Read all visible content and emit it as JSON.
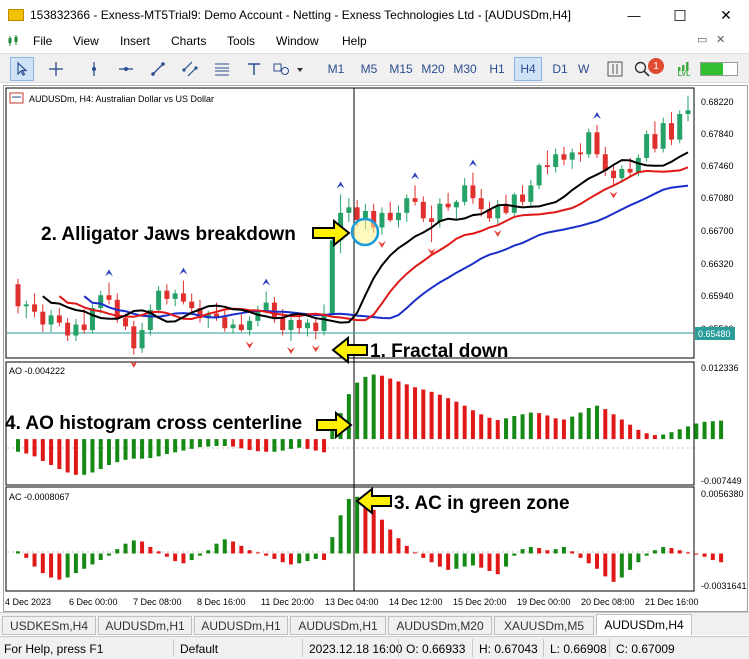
{
  "window": {
    "title": "153832366 - Exness-MT5Trial9: Demo Account - Netting - Exness Technologies Ltd - [AUDUSDm,H4]",
    "minimize_glyph": "—",
    "maximize_glyph": "☐",
    "close_glyph": "✕",
    "restore_glyph": "▭",
    "inner_close_glyph": "✕"
  },
  "menu": {
    "items": [
      "File",
      "View",
      "Insert",
      "Charts",
      "Tools",
      "Window",
      "Help"
    ]
  },
  "toolbar": {
    "timeframes": [
      "M1",
      "M5",
      "M15",
      "M20",
      "M30",
      "H1",
      "H4",
      "D1",
      "W"
    ],
    "active_timeframe": "H4",
    "notification_count": "1",
    "lvl_label": "LVL",
    "icons": [
      "cursor-icon",
      "crosshair-icon",
      "vertical-line-icon",
      "horizontal-line-icon",
      "trendline-icon",
      "channel-icon",
      "fibonacci-icon",
      "text-icon",
      "shapes-icon",
      "chart-type-icon",
      "search-icon",
      "notification-icon",
      "signal-icon"
    ]
  },
  "chart": {
    "symbol_label": "AUDUSDm, H4:  Australian Dollar vs US Dollar",
    "price_labels": [
      "0.68220",
      "0.67840",
      "0.67460",
      "0.67080",
      "0.66700",
      "0.66320",
      "0.65940",
      "0.65560"
    ],
    "current_price": "0.65480",
    "ao_label": "AO -0.004222",
    "ao_max": "0.012336",
    "ao_min": "-0.007449",
    "ac_label": "AC -0.0008067",
    "ac_max": "0.0056380",
    "ac_min": "-0.0031641",
    "date_labels": [
      "4 Dec 2023",
      "6 Dec 00:00",
      "7 Dec 08:00",
      "8 Dec 16:00",
      "11 Dec 20:00",
      "13 Dec 04:00",
      "14 Dec 12:00",
      "15 Dec 20:00",
      "19 Dec 00:00",
      "20 Dec 08:00",
      "21 Dec 16:00"
    ],
    "annotations": {
      "jaws": "2. Alligator Jaws breakdown",
      "fractal": "1. Fractal down",
      "ao": "4. AO histogram cross centerline",
      "ac": "3. AC in green zone"
    },
    "colors": {
      "bull": "#26a269",
      "bear": "#e0302e",
      "jaws": "#1a2ecc",
      "teeth": "#e01818",
      "lips": "#000000",
      "fractal_up": "#2b3fbf",
      "fractal_down": "#e33d2e",
      "arrow_fill": "#ffef00",
      "ao_green": "#148a14",
      "ao_red": "#e01818"
    }
  },
  "chart_data": {
    "type": "candlestick",
    "symbol": "AUDUSDm",
    "timeframe": "H4",
    "ylim": [
      0.6548,
      0.6832
    ],
    "price_series": [
      [
        0.6622,
        0.6628,
        0.659,
        0.6598
      ],
      [
        0.6598,
        0.6604,
        0.6585,
        0.66
      ],
      [
        0.66,
        0.6612,
        0.6586,
        0.6592
      ],
      [
        0.6592,
        0.66,
        0.657,
        0.6578
      ],
      [
        0.6578,
        0.6594,
        0.657,
        0.6588
      ],
      [
        0.6588,
        0.6596,
        0.6576,
        0.658
      ],
      [
        0.658,
        0.6585,
        0.656,
        0.6566
      ],
      [
        0.6566,
        0.6584,
        0.656,
        0.6578
      ],
      [
        0.6578,
        0.6595,
        0.6568,
        0.6572
      ],
      [
        0.6572,
        0.66,
        0.6568,
        0.6596
      ],
      [
        0.6596,
        0.6615,
        0.659,
        0.661
      ],
      [
        0.661,
        0.6624,
        0.66,
        0.6605
      ],
      [
        0.6605,
        0.6612,
        0.658,
        0.6585
      ],
      [
        0.6585,
        0.659,
        0.6572,
        0.6576
      ],
      [
        0.6576,
        0.6582,
        0.6545,
        0.6552
      ],
      [
        0.6552,
        0.658,
        0.6547,
        0.6572
      ],
      [
        0.6572,
        0.66,
        0.6566,
        0.6594
      ],
      [
        0.6594,
        0.662,
        0.659,
        0.6615
      ],
      [
        0.6615,
        0.6622,
        0.66,
        0.6606
      ],
      [
        0.6606,
        0.6616,
        0.6598,
        0.6612
      ],
      [
        0.6612,
        0.6626,
        0.66,
        0.6603
      ],
      [
        0.6603,
        0.6612,
        0.659,
        0.6596
      ],
      [
        0.6596,
        0.6605,
        0.658,
        0.6585
      ],
      [
        0.6585,
        0.6593,
        0.6574,
        0.659
      ],
      [
        0.659,
        0.6602,
        0.6582,
        0.6586
      ],
      [
        0.6586,
        0.6595,
        0.657,
        0.6574
      ],
      [
        0.6574,
        0.6584,
        0.6568,
        0.6578
      ],
      [
        0.6578,
        0.659,
        0.657,
        0.6572
      ],
      [
        0.6572,
        0.6587,
        0.6566,
        0.6582
      ],
      [
        0.6582,
        0.6599,
        0.6576,
        0.6594
      ],
      [
        0.6594,
        0.6614,
        0.659,
        0.6602
      ],
      [
        0.6602,
        0.6608,
        0.658,
        0.6586
      ],
      [
        0.6586,
        0.6595,
        0.6566,
        0.6572
      ],
      [
        0.6572,
        0.6586,
        0.656,
        0.6583
      ],
      [
        0.6583,
        0.659,
        0.6568,
        0.6574
      ],
      [
        0.6574,
        0.6584,
        0.6565,
        0.658
      ],
      [
        0.658,
        0.6584,
        0.6562,
        0.6571
      ],
      [
        0.6571,
        0.66,
        0.6566,
        0.659
      ],
      [
        0.659,
        0.6673,
        0.6588,
        0.667
      ],
      [
        0.667,
        0.672,
        0.6656,
        0.67
      ],
      [
        0.67,
        0.6716,
        0.669,
        0.6706
      ],
      [
        0.6706,
        0.6714,
        0.6685,
        0.6692
      ],
      [
        0.6692,
        0.671,
        0.6682,
        0.6702
      ],
      [
        0.6702,
        0.671,
        0.6678,
        0.6684
      ],
      [
        0.6684,
        0.6706,
        0.6676,
        0.67
      ],
      [
        0.67,
        0.6712,
        0.669,
        0.6692
      ],
      [
        0.6692,
        0.6708,
        0.6684,
        0.67
      ],
      [
        0.67,
        0.672,
        0.669,
        0.6716
      ],
      [
        0.6716,
        0.673,
        0.6708,
        0.6712
      ],
      [
        0.6712,
        0.6718,
        0.669,
        0.6694
      ],
      [
        0.6694,
        0.6708,
        0.6668,
        0.669
      ],
      [
        0.669,
        0.6716,
        0.6684,
        0.671
      ],
      [
        0.671,
        0.6722,
        0.6702,
        0.6706
      ],
      [
        0.6706,
        0.6714,
        0.6692,
        0.6712
      ],
      [
        0.6712,
        0.6738,
        0.6708,
        0.673
      ],
      [
        0.673,
        0.6744,
        0.671,
        0.6716
      ],
      [
        0.6716,
        0.6726,
        0.6696,
        0.6704
      ],
      [
        0.6704,
        0.6712,
        0.669,
        0.6694
      ],
      [
        0.6694,
        0.6714,
        0.6688,
        0.6708
      ],
      [
        0.6708,
        0.672,
        0.6698,
        0.67
      ],
      [
        0.67,
        0.6722,
        0.6696,
        0.672
      ],
      [
        0.672,
        0.673,
        0.6708,
        0.6712
      ],
      [
        0.6712,
        0.6736,
        0.6706,
        0.673
      ],
      [
        0.673,
        0.6754,
        0.6726,
        0.6752
      ],
      [
        0.6752,
        0.6768,
        0.6742,
        0.675
      ],
      [
        0.675,
        0.677,
        0.6744,
        0.6764
      ],
      [
        0.6764,
        0.6772,
        0.6752,
        0.6758
      ],
      [
        0.6758,
        0.677,
        0.6748,
        0.6766
      ],
      [
        0.6766,
        0.6776,
        0.6756,
        0.6764
      ],
      [
        0.6764,
        0.6792,
        0.676,
        0.6788
      ],
      [
        0.6788,
        0.6796,
        0.676,
        0.6764
      ],
      [
        0.6764,
        0.6772,
        0.674,
        0.6746
      ],
      [
        0.6746,
        0.6752,
        0.673,
        0.6738
      ],
      [
        0.6738,
        0.6752,
        0.6734,
        0.6748
      ],
      [
        0.6748,
        0.676,
        0.674,
        0.6744
      ],
      [
        0.6744,
        0.6764,
        0.674,
        0.676
      ],
      [
        0.676,
        0.679,
        0.6756,
        0.6786
      ],
      [
        0.6786,
        0.68,
        0.6766,
        0.677
      ],
      [
        0.677,
        0.6804,
        0.6766,
        0.6798
      ],
      [
        0.6798,
        0.681,
        0.6774,
        0.678
      ],
      [
        0.678,
        0.6812,
        0.6776,
        0.6808
      ],
      [
        0.6808,
        0.6828,
        0.68,
        0.6812
      ]
    ],
    "indicators": [
      "Alligator",
      "Fractals",
      "Awesome Oscillator",
      "Accelerator Oscillator"
    ],
    "ao": {
      "ylim": [
        -0.007449,
        0.012336
      ],
      "values": [
        -0.0022,
        -0.0025,
        -0.003,
        -0.0038,
        -0.0045,
        -0.0052,
        -0.0058,
        -0.0062,
        -0.0062,
        -0.0058,
        -0.0052,
        -0.0045,
        -0.004,
        -0.0036,
        -0.0034,
        -0.0034,
        -0.0033,
        -0.003,
        -0.0026,
        -0.0023,
        -0.002,
        -0.0017,
        -0.0014,
        -0.0013,
        -0.0012,
        -0.0012,
        -0.0013,
        -0.0016,
        -0.0019,
        -0.0021,
        -0.0022,
        -0.0022,
        -0.002,
        -0.0017,
        -0.0015,
        -0.0017,
        -0.002,
        -0.0023,
        0.0015,
        0.0045,
        0.0078,
        0.0098,
        0.0108,
        0.0112,
        0.011,
        0.0105,
        0.01,
        0.0095,
        0.009,
        0.0086,
        0.0082,
        0.0077,
        0.0071,
        0.0065,
        0.0058,
        0.005,
        0.0043,
        0.0037,
        0.0033,
        0.0036,
        0.004,
        0.0043,
        0.0046,
        0.0045,
        0.0041,
        0.0036,
        0.0034,
        0.0039,
        0.0046,
        0.0054,
        0.0058,
        0.0052,
        0.0043,
        0.0034,
        0.0025,
        0.0016,
        0.001,
        0.0007,
        0.0008,
        0.0012,
        0.0017,
        0.0022,
        0.0027,
        0.003,
        0.0031,
        0.0032
      ]
    },
    "ac": {
      "ylim": [
        -0.0031641,
        0.005638
      ],
      "values": [
        0.0002,
        -0.0004,
        -0.0012,
        -0.0018,
        -0.0022,
        -0.0024,
        -0.0022,
        -0.0018,
        -0.0014,
        -0.001,
        -0.0006,
        -0.0002,
        0.0004,
        0.0009,
        0.0012,
        0.0011,
        0.0006,
        0.0002,
        -0.0003,
        -0.0007,
        -0.0009,
        -0.0006,
        -0.0002,
        0.0003,
        0.0009,
        0.0013,
        0.0011,
        0.0007,
        0.0003,
        0.0001,
        -0.0002,
        -0.0005,
        -0.0008,
        -0.001,
        -0.0009,
        -0.0007,
        -0.0005,
        -0.0006,
        0.0015,
        0.0035,
        0.005,
        0.0052,
        0.0048,
        0.004,
        0.0031,
        0.0022,
        0.0014,
        0.0007,
        0.0001,
        -0.0004,
        -0.0008,
        -0.0012,
        -0.0015,
        -0.0014,
        -0.0012,
        -0.0011,
        -0.0013,
        -0.0016,
        -0.0019,
        -0.0012,
        -0.0002,
        0.0004,
        0.0006,
        0.0005,
        0.0003,
        0.0004,
        0.0006,
        0.0002,
        -0.0004,
        -0.0009,
        -0.0014,
        -0.0021,
        -0.0026,
        -0.0022,
        -0.0015,
        -0.0008,
        -0.0002,
        0.0003,
        0.0006,
        0.0005,
        0.0003,
        0.0001,
        -0.0001,
        -0.0003,
        -0.0006,
        -0.0008
      ]
    }
  },
  "tabs": [
    "USDKESm,H4",
    "AUDUSDm,H1",
    "AUDUSDm,H1",
    "AUDUSDm,H1",
    "AUDUSDm,M20",
    "XAUUSDm,M5",
    "AUDUSDm,H4"
  ],
  "active_tab": "AUDUSDm,H4",
  "status": {
    "help": "For Help, press F1",
    "profile": "Default",
    "datetime": "2023.12.18 16:00",
    "open": "O: 0.66933",
    "high": "H: 0.67043",
    "low": "L: 0.66908",
    "close": "C: 0.67009"
  }
}
